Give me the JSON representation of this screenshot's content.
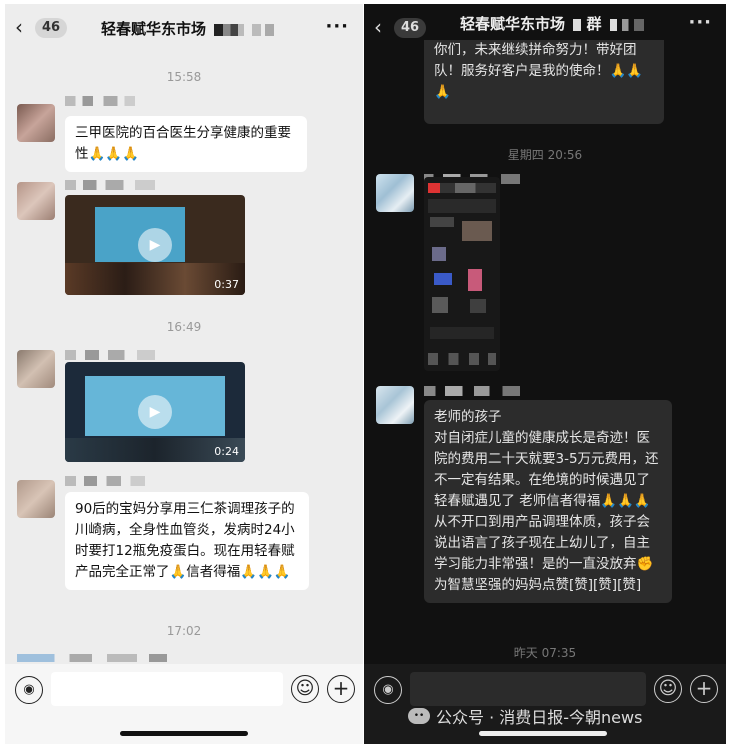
{
  "left": {
    "back_icon": "‹",
    "badge": "46",
    "title": "轻春赋华东市场",
    "more_icon": "···",
    "messages": [
      {
        "time": "15:58",
        "text": "三甲医院的百合医生分享健康的重要性🙏🙏🙏"
      },
      {
        "video_duration": "0:37"
      },
      {
        "time": "16:49",
        "video_duration": "0:24"
      },
      {
        "text": "90后的宝妈分享用三仁茶调理孩子的川崎病，全身性血管炎，发病时24小时要打12瓶免疫蛋白。现在用轻春赋产品完全正常了🙏信者得福🙏🙏🙏"
      },
      {
        "time": "17:02"
      }
    ],
    "bottom": {
      "voice_icon": "◉",
      "emoji_icon": "☺",
      "plus_icon": "+"
    }
  },
  "right": {
    "back_icon": "‹",
    "badge": "46",
    "title": "轻春赋华东市场",
    "title_suffix": "群",
    "more_icon": "···",
    "top_bubble": "你们，未来继续拼命努力！带好团队！服务好客户是我的使命！🙏🙏🙏",
    "time1": "星期四 20:56",
    "second_bubble": "老师的孩子\n对自闭症儿童的健康成长是奇迹！医院的费用二十天就要3-5万元费用，还不一定有结果。在绝境的时候遇见了轻春赋遇见了 老师信者得福🙏🙏🙏从不开口到用产品调理体质，孩子会说出语言了孩子现在上幼儿了，自主学习能力非常强！是的一直没放弃✊为智慧坚强的妈妈点赞[赞][赞][赞]",
    "time2": "昨天 07:35",
    "bottom": {
      "voice_icon": "◉",
      "emoji_icon": "☺",
      "plus_icon": "+"
    },
    "watermark": "公众号 · 消费日报-今朝news"
  },
  "colors": {
    "left_bg": "#ededed",
    "right_bg": "#111111",
    "bubble_dark": "#2c2c2c"
  }
}
